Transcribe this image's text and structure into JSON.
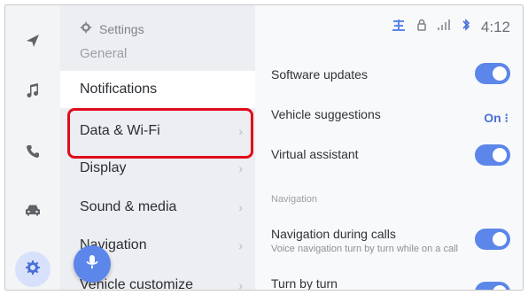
{
  "header": {
    "settings_label": "Settings",
    "general_label": "General",
    "time": "4:12"
  },
  "rail": {
    "items": [
      {
        "name": "navigation-icon"
      },
      {
        "name": "music-icon"
      },
      {
        "name": "phone-icon"
      },
      {
        "name": "car-icon"
      },
      {
        "name": "settings-icon",
        "active": true
      }
    ]
  },
  "menu": {
    "items": [
      {
        "label": "Notifications",
        "active": true
      },
      {
        "label": "Data & Wi-Fi",
        "active": false
      },
      {
        "label": "Display",
        "active": false
      },
      {
        "label": "Sound & media",
        "active": false
      },
      {
        "label": "Navigation",
        "active": false
      },
      {
        "label": "Vehicle customize",
        "active": false
      }
    ],
    "chevron": "›"
  },
  "content": {
    "rows": [
      {
        "title": "Software updates",
        "control": "toggle",
        "state": true
      },
      {
        "title": "Vehicle suggestions",
        "control": "text",
        "value": "On ⁝"
      },
      {
        "title": "Virtual assistant",
        "control": "toggle",
        "state": true
      }
    ],
    "section_title": "Navigation",
    "nav_rows": [
      {
        "title": "Navigation during calls",
        "desc": "Voice navigation turn by turn while on a call",
        "control": "toggle",
        "state": true
      },
      {
        "title": "Turn by turn",
        "control": "toggle",
        "state": true
      }
    ]
  },
  "colors": {
    "accent": "#5c86ea",
    "highlight": "#e10b1c",
    "menu_bg": "#eceef1",
    "rail_active_bg": "#d7e1fb"
  }
}
